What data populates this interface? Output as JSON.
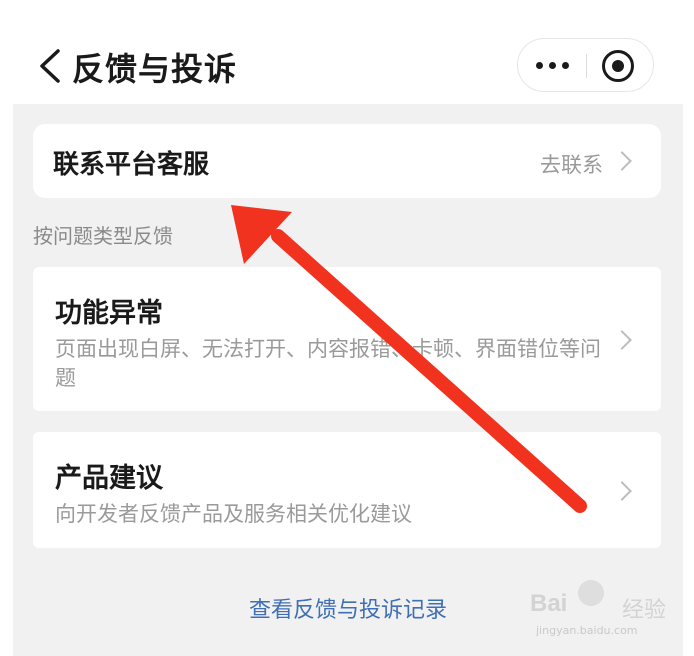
{
  "header": {
    "title": "反馈与投诉",
    "back_icon": "chevron-left-icon",
    "more_icon": "more-dots-icon",
    "close_icon": "target-close-icon"
  },
  "contact": {
    "label": "联系平台客服",
    "action": "去联系"
  },
  "section_label": "按问题类型反馈",
  "categories": [
    {
      "title": "功能异常",
      "description": "页面出现白屏、无法打开、内容报错、卡顿、界面错位等问题"
    },
    {
      "title": "产品建议",
      "description": "向开发者反馈产品及服务相关优化建议"
    }
  ],
  "record_link": "查看反馈与投诉记录",
  "watermark": {
    "brand": "Bai",
    "brand_suffix": "经验",
    "url": "jingyan.baidu.com"
  },
  "colors": {
    "annotation_arrow": "#f0321e",
    "link": "#3f6fb5",
    "background": "#f1f1f1"
  }
}
